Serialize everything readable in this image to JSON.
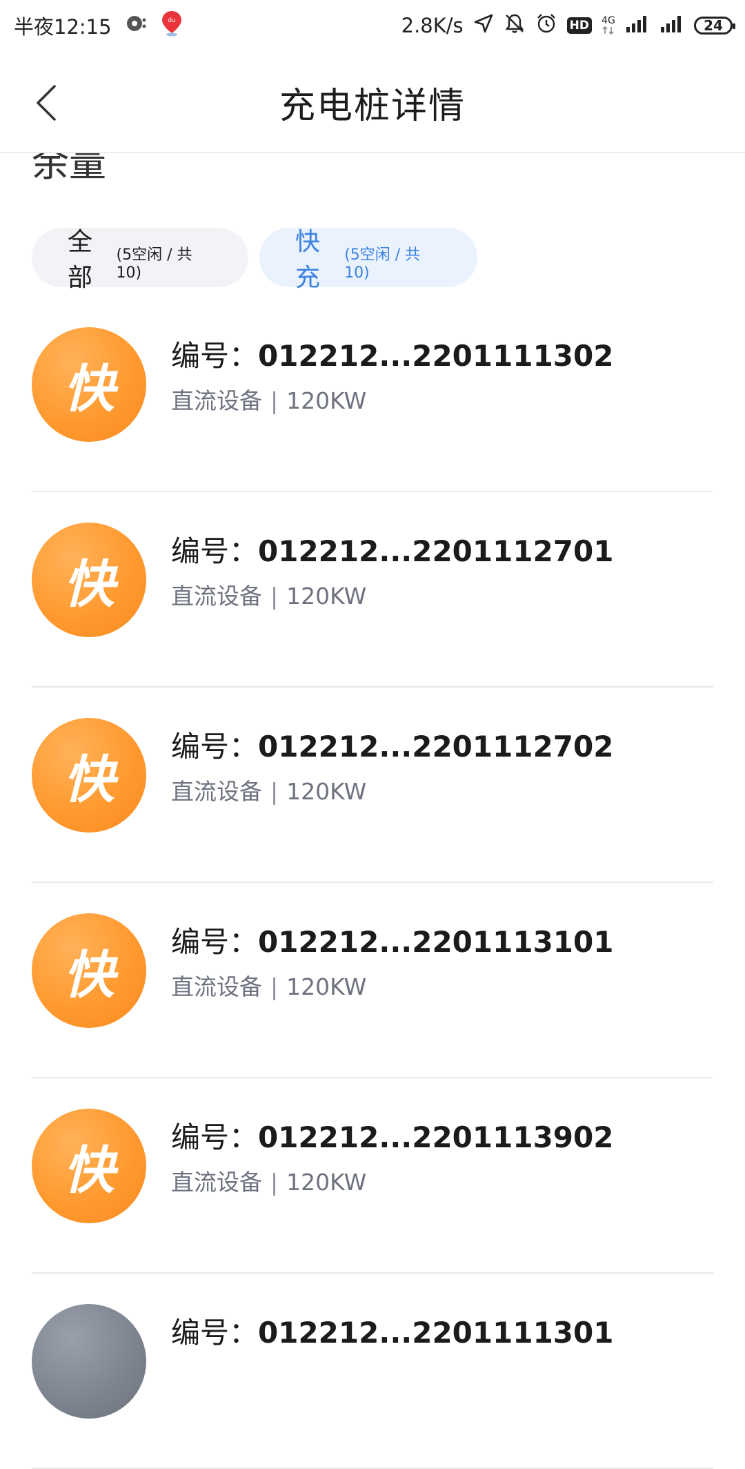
{
  "status_bar": {
    "time": "半夜12:15",
    "speed": "2.8K/s",
    "network": "4G",
    "hd": "HD",
    "battery": "24"
  },
  "header": {
    "title": "充电桩详情"
  },
  "cut_text": "余量",
  "tabs": [
    {
      "label": "全部",
      "count": "(5空闲 / 共10)",
      "selected": false
    },
    {
      "label": "快充",
      "count": "(5空闲 / 共10)",
      "selected": true
    }
  ],
  "piles": [
    {
      "icon": "快",
      "id_label": "编号：",
      "id": "012212...2201111302",
      "type": "直流设备",
      "power": "120KW"
    },
    {
      "icon": "快",
      "id_label": "编号：",
      "id": "012212...2201112701",
      "type": "直流设备",
      "power": "120KW"
    },
    {
      "icon": "快",
      "id_label": "编号：",
      "id": "012212...2201112702",
      "type": "直流设备",
      "power": "120KW"
    },
    {
      "icon": "快",
      "id_label": "编号：",
      "id": "012212...2201113101",
      "type": "直流设备",
      "power": "120KW"
    },
    {
      "icon": "快",
      "id_label": "编号：",
      "id": "012212...2201113902",
      "type": "直流设备",
      "power": "120KW"
    },
    {
      "icon": "",
      "id_label": "编号：",
      "id": "012212...2201111301",
      "type": "",
      "power": ""
    }
  ],
  "colors": {
    "accent": "#3c82e0",
    "fast_icon": "#ff9a30",
    "idle_icon": "#7d838e"
  }
}
